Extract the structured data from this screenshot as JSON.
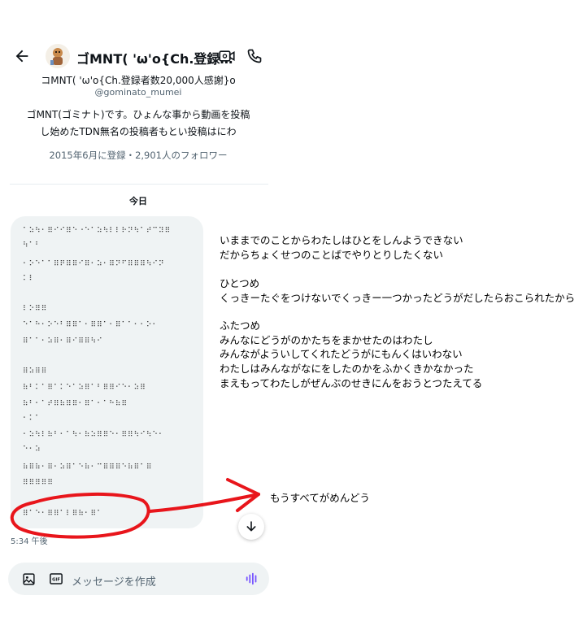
{
  "header": {
    "title": "ゴMNT( 'ω'o{Ch.登録…",
    "colors": {
      "accent": "#1d9bf0",
      "annotation": "#e8151b"
    }
  },
  "profile": {
    "name": "コMNT( 'ω'o{Ch.登録者数20,000人感謝}o",
    "handle": "@gominato_mumei",
    "bio_lines": [
      "ゴMNT(ゴミナト)です。ひょんな事から動画を投稿",
      "し始めたTDN無名の投稿者もとい投稿はにわ"
    ],
    "meta": "2015年6月に登録・2,901人のフォロワー"
  },
  "conversation": {
    "date_label": "今日",
    "braille_lines": [
      "⠁⠵⠳⠂⠿⠊⠊⠿⠑⠐⠑⠁⠵⠳⠇⠇⠗⠝⠳⠁⠞⠉⠽⠿",
      "⠳⠁⠃",
      "⠂⠕⠑⠁⠁⠿⠟⠿⠿⠊⠿⠂⠵⠂⠿⠝⠋⠿⠿⠿⠳⠊⠝",
      "⠅⠇",
      "⠇⠕⠿⠿",
      "⠑⠁⠓⠂⠕⠑⠃⠿⠿⠁⠂⠿⠿⠁⠂⠿⠁⠁⠂⠂⠕⠂",
      "⠿⠁⠁⠂⠵⠿⠂⠿⠊⠿⠿⠳⠊",
      "⠿⠵⠿⠿",
      "⠷⠃⠅⠁⠿⠁⠅⠑⠁⠵⠿⠁⠃⠿⠿⠊⠑⠂⠵⠿",
      "⠷⠃⠂⠁⠞⠿⠷⠿⠿⠂⠿⠁⠂⠁⠓⠷⠿",
      "⠂⠅⠁",
      "⠂⠵⠳⠇⠷⠃⠂⠁⠳⠂⠷⠵⠿⠿⠑⠂⠿⠿⠳⠊⠳⠑⠂",
      "⠑⠂⠵",
      "⠷⠿⠷⠂⠿⠂⠵⠿⠁⠑⠷⠂⠉⠿⠿⠿⠑⠷⠿⠁⠿",
      "⠿⠿⠿⠿⠿",
      "⠿⠁⠑⠂⠿⠿⠁⠇⠿⠷⠂⠿⠁"
    ],
    "time_label": "5:34 午後",
    "composer_placeholder": "メッセージを作成"
  },
  "notes": {
    "block1": [
      "いままでのことからわたしはひとをしんようできない",
      "だからちょくせつのことばでやりとりしたくない"
    ],
    "block2": [
      "ひとつめ",
      "くっきーたぐをつけないでくっきー一つかったどうがだしたらおこられたから"
    ],
    "block3": [
      "ふたつめ",
      "みんなにどうがのかたちをまかせたのはわたし",
      "みんながよういしてくれたどうがにもんくはいわない",
      "わたしはみんながなにをしたのかをふかくきかなかった",
      "まえもってわたしがぜんぶのせきにんをおうとつたえてる"
    ],
    "final": "もうすべてがめんどう"
  },
  "icons": [
    "back-arrow-icon",
    "video-icon",
    "phone-icon",
    "image-icon",
    "gif-icon",
    "voice-icon",
    "arrow-down-icon"
  ]
}
